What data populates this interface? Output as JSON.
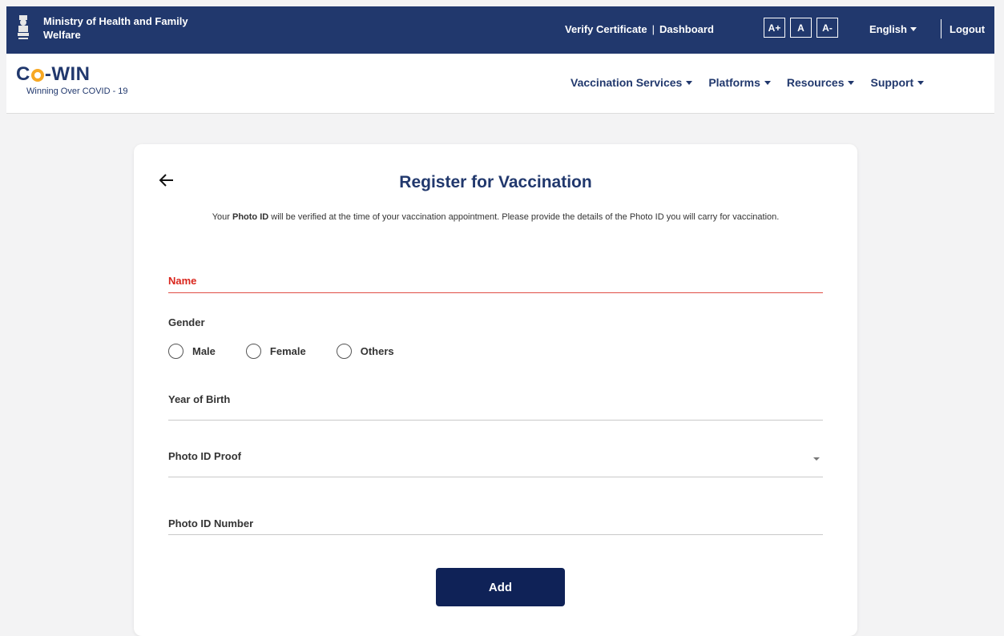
{
  "topbar": {
    "ministry": "Ministry of Health and Family Welfare",
    "verify_certificate": "Verify Certificate",
    "separator": "|",
    "dashboard": "Dashboard",
    "font_buttons": [
      "A+",
      "A",
      "A-"
    ],
    "language": "English",
    "logout": "Logout",
    "color": "#21386d"
  },
  "header": {
    "logo_prefix": "C",
    "logo_suffix": "-WIN",
    "tagline": "Winning Over COVID - 19",
    "nav": [
      "Vaccination Services",
      "Platforms",
      "Resources",
      "Support"
    ]
  },
  "form": {
    "title": "Register for Vaccination",
    "intro_prefix": "Your ",
    "intro_bold": "Photo ID",
    "intro_suffix": " will be verified at the time of your vaccination appointment. Please provide the details of the Photo ID you will carry for vaccination.",
    "name_label": "Name",
    "gender_label": "Gender",
    "gender_options": [
      "Male",
      "Female",
      "Others"
    ],
    "yob_label": "Year of Birth",
    "photo_id_proof_label": "Photo ID Proof",
    "photo_id_number_label": "Photo ID Number",
    "add_button": "Add"
  },
  "colors": {
    "brand_navy": "#21386d",
    "button_navy": "#0f2257",
    "error_red": "#d9251c",
    "logo_orange": "#f7a823"
  }
}
